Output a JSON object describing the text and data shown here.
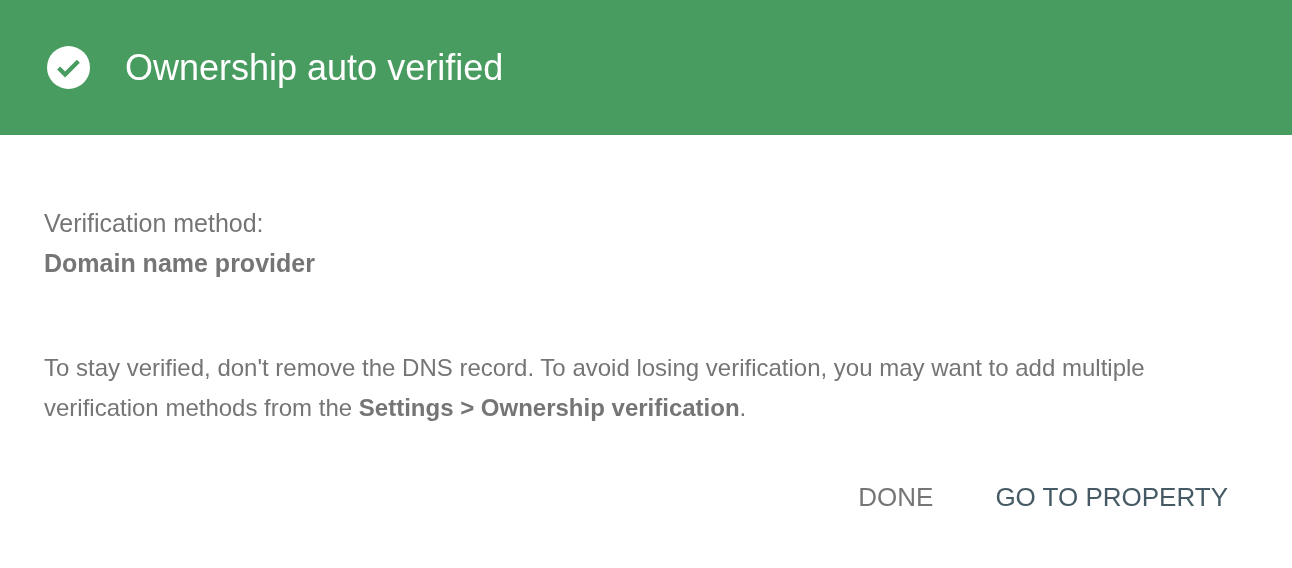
{
  "header": {
    "title": "Ownership auto verified"
  },
  "method": {
    "label": "Verification method:",
    "value": "Domain name provider"
  },
  "message": "To stay verified, don't remove the DNS record. To avoid losing verification, you may want to add multiple verification methods from the **Settings > Ownership verification**.",
  "buttons": [
    {
      "label": "DONE",
      "kind": "secondary"
    },
    {
      "label": "GO TO PROPERTY",
      "kind": "primary"
    }
  ]
}
